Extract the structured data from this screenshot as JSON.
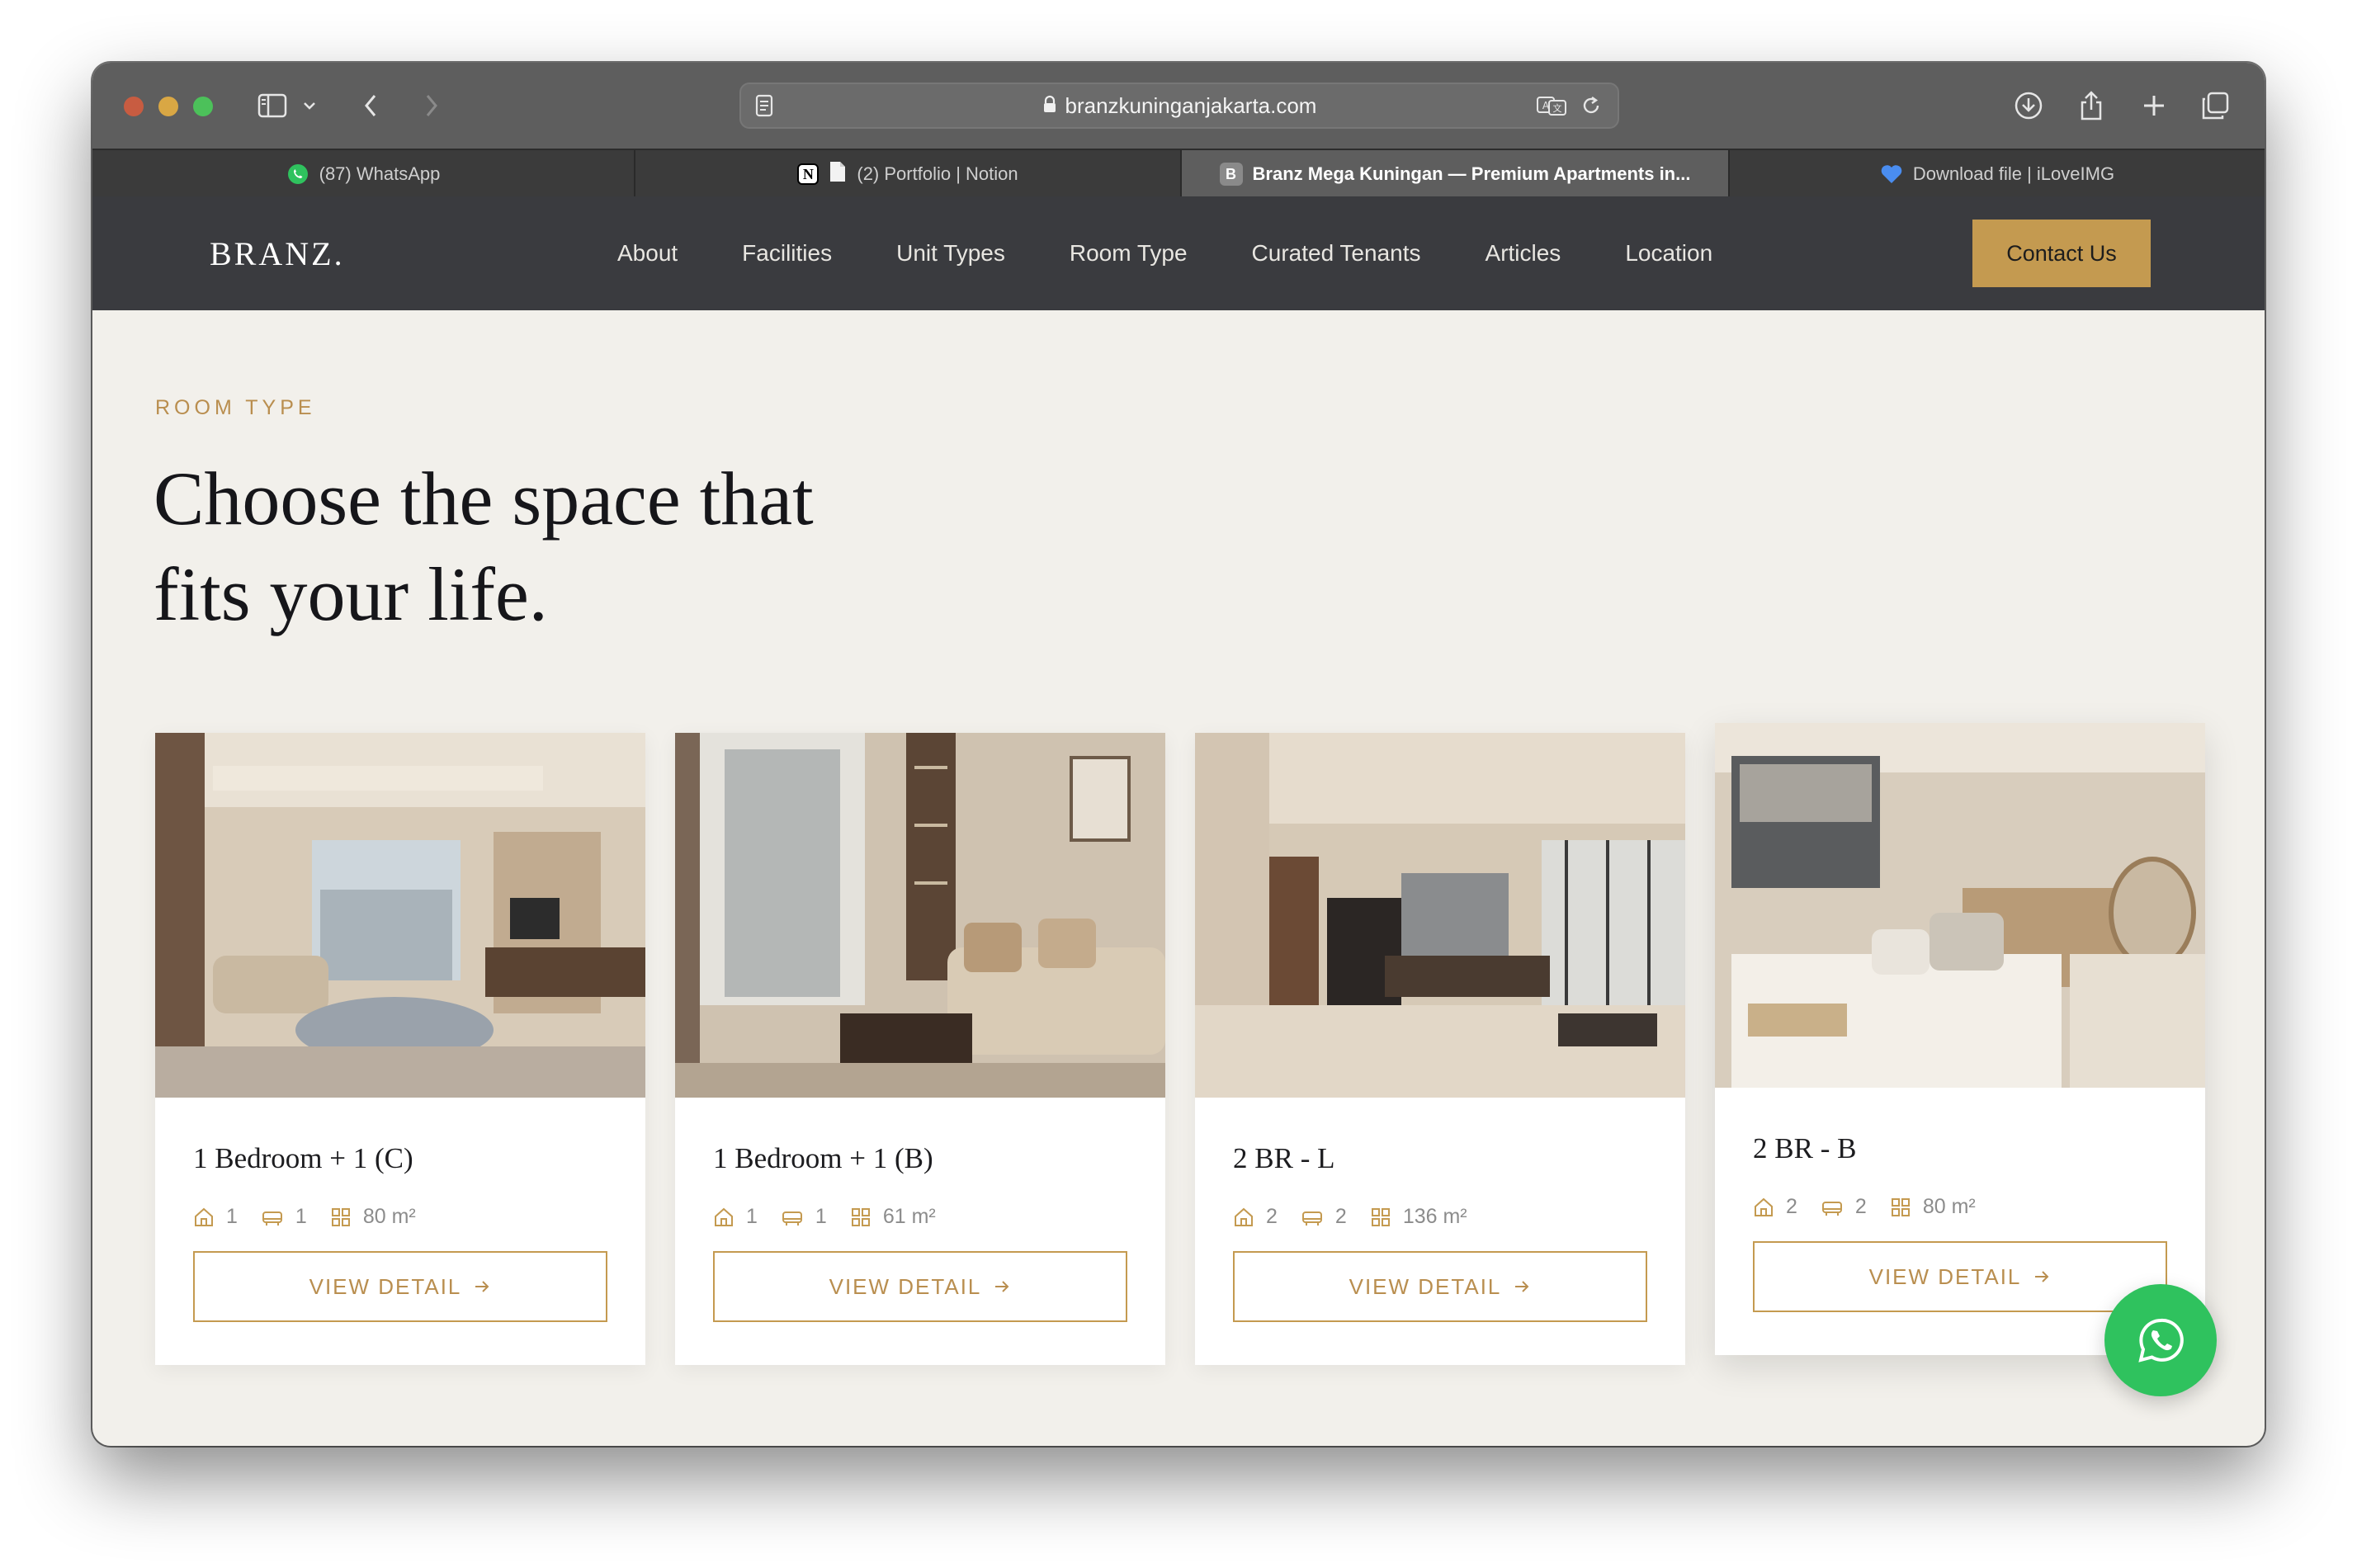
{
  "browser": {
    "url": "branzkuninganjakarta.com",
    "tabs": [
      {
        "label": "(87) WhatsApp",
        "favicon": "whatsapp-icon"
      },
      {
        "label": "(2) Portfolio | Notion",
        "favicon": "notion-icon"
      },
      {
        "label": "Branz Mega Kuningan — Premium Apartments in...",
        "favicon": "B",
        "active": true
      },
      {
        "label": "Download file | iLoveIMG",
        "favicon": "heart-icon"
      }
    ]
  },
  "site": {
    "brand": "BRANZ.",
    "nav": [
      "About",
      "Facilities",
      "Unit Types",
      "Room Type",
      "Curated Tenants",
      "Articles",
      "Location"
    ],
    "contact_label": "Contact Us",
    "accent": "#c49a50",
    "nav_bg": "#3a3b3f"
  },
  "section": {
    "eyebrow": "ROOM TYPE",
    "headline_line1": "Choose the space that",
    "headline_line2": "fits your life."
  },
  "cards": [
    {
      "title": "1 Bedroom + 1 (C)",
      "bedrooms": "1",
      "bathrooms": "1",
      "area": "80 m²",
      "button": "VIEW DETAIL"
    },
    {
      "title": "1 Bedroom + 1 (B)",
      "bedrooms": "1",
      "bathrooms": "1",
      "area": "61 m²",
      "button": "VIEW DETAIL"
    },
    {
      "title": "2 BR - L",
      "bedrooms": "2",
      "bathrooms": "2",
      "area": "136 m²",
      "button": "VIEW DETAIL"
    },
    {
      "title": "2 BR - B",
      "bedrooms": "2",
      "bathrooms": "2",
      "area": "80 m²",
      "button": "VIEW DETAIL"
    }
  ]
}
